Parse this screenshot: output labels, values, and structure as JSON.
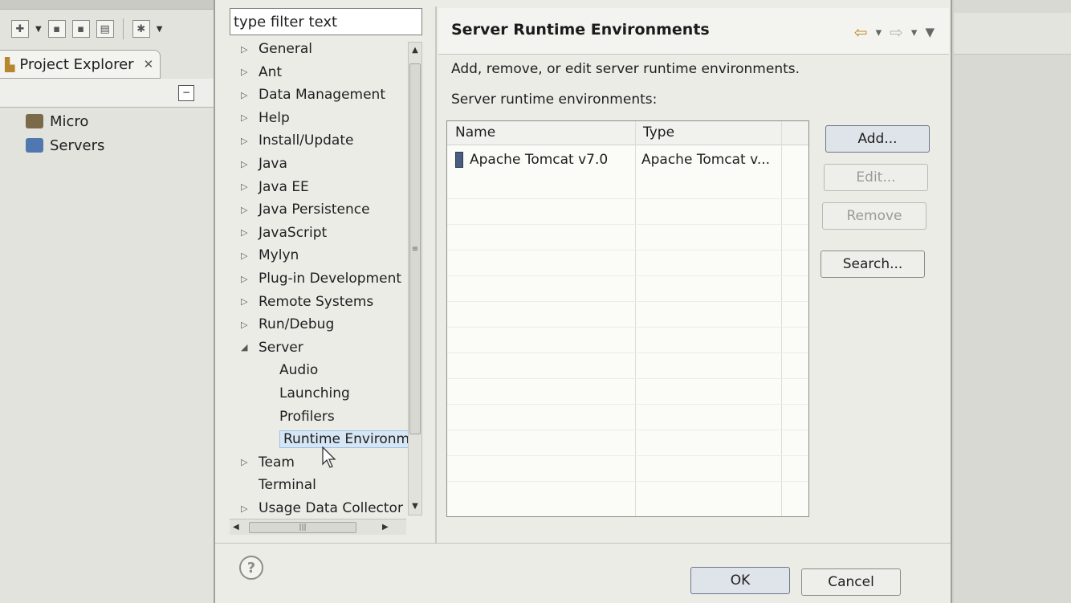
{
  "workbench": {
    "project_explorer_title": "Project Explorer",
    "tree": [
      {
        "label": "Micro",
        "icon": "project-icon"
      },
      {
        "label": "Servers",
        "icon": "servers-folder-icon"
      }
    ]
  },
  "filter": {
    "placeholder": "type filter text"
  },
  "nav_tree": {
    "items": [
      {
        "label": "General",
        "state": "collapsed"
      },
      {
        "label": "Ant",
        "state": "collapsed"
      },
      {
        "label": "Data Management",
        "state": "collapsed"
      },
      {
        "label": "Help",
        "state": "collapsed"
      },
      {
        "label": "Install/Update",
        "state": "collapsed"
      },
      {
        "label": "Java",
        "state": "collapsed"
      },
      {
        "label": "Java EE",
        "state": "collapsed"
      },
      {
        "label": "Java Persistence",
        "state": "collapsed"
      },
      {
        "label": "JavaScript",
        "state": "collapsed"
      },
      {
        "label": "Mylyn",
        "state": "collapsed"
      },
      {
        "label": "Plug-in Development",
        "state": "collapsed"
      },
      {
        "label": "Remote Systems",
        "state": "collapsed"
      },
      {
        "label": "Run/Debug",
        "state": "collapsed"
      },
      {
        "label": "Server",
        "state": "expanded"
      },
      {
        "label": "Audio",
        "state": "child"
      },
      {
        "label": "Launching",
        "state": "child"
      },
      {
        "label": "Profilers",
        "state": "child"
      },
      {
        "label": "Runtime Environm",
        "state": "child-selected"
      },
      {
        "label": "Team",
        "state": "collapsed"
      },
      {
        "label": "Terminal",
        "state": "leaf"
      },
      {
        "label": "Usage Data Collector",
        "state": "collapsed"
      }
    ]
  },
  "page": {
    "title": "Server Runtime Environments",
    "description": "Add, remove, or edit server runtime environments.",
    "table_label": "Server runtime environments:",
    "columns": [
      "Name",
      "Type"
    ],
    "rows": [
      {
        "name": "Apache Tomcat v7.0",
        "type": "Apache Tomcat v..."
      }
    ]
  },
  "buttons": {
    "add": "Add...",
    "edit": "Edit...",
    "remove": "Remove",
    "search": "Search...",
    "ok": "OK",
    "cancel": "Cancel",
    "help": "?"
  },
  "colors": {
    "selection": "#d6e6f5",
    "accent_back_arrow": "#c08a2b"
  }
}
